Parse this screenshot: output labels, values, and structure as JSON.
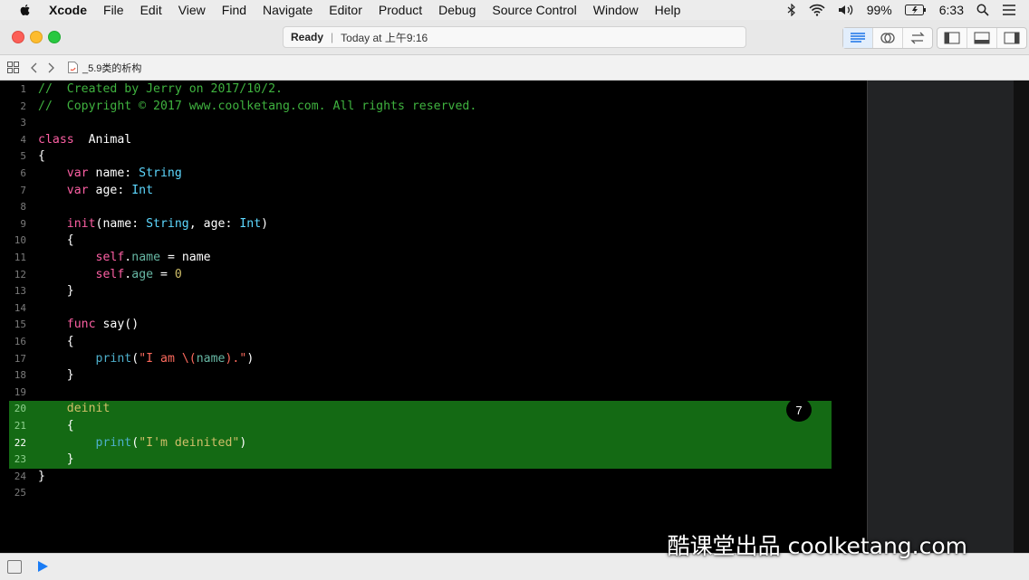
{
  "menubar": {
    "app": "Xcode",
    "items": [
      "File",
      "Edit",
      "View",
      "Find",
      "Navigate",
      "Editor",
      "Product",
      "Debug",
      "Source Control",
      "Window",
      "Help"
    ],
    "battery": "99%",
    "time": "6:33"
  },
  "toolbar": {
    "status": "Ready",
    "time": "Today at 上午9:16"
  },
  "jumpbar": {
    "file": "_5.9类的析构"
  },
  "editor": {
    "badge": "7",
    "highlight_color": "#146a14"
  },
  "code_lines": [
    {
      "n": "1",
      "segs": [
        [
          "c-comment",
          "//  Created by Jerry on 2017/10/2."
        ]
      ]
    },
    {
      "n": "2",
      "segs": [
        [
          "c-comment",
          "//  Copyright © 2017 www.coolketang.com. All rights reserved."
        ]
      ]
    },
    {
      "n": "3",
      "segs": []
    },
    {
      "n": "4",
      "segs": [
        [
          "c-key",
          "class"
        ],
        [
          "",
          "  Animal"
        ]
      ]
    },
    {
      "n": "5",
      "segs": [
        [
          "",
          "{"
        ]
      ]
    },
    {
      "n": "6",
      "segs": [
        [
          "",
          "    "
        ],
        [
          "c-key",
          "var"
        ],
        [
          "",
          " name: "
        ],
        [
          "c-type",
          "String"
        ]
      ]
    },
    {
      "n": "7",
      "segs": [
        [
          "",
          "    "
        ],
        [
          "c-key",
          "var"
        ],
        [
          "",
          " age: "
        ],
        [
          "c-type",
          "Int"
        ]
      ]
    },
    {
      "n": "8",
      "segs": []
    },
    {
      "n": "9",
      "segs": [
        [
          "",
          "    "
        ],
        [
          "c-key",
          "init"
        ],
        [
          "",
          "(name: "
        ],
        [
          "c-type",
          "String"
        ],
        [
          "",
          ", age: "
        ],
        [
          "c-type",
          "Int"
        ],
        [
          "",
          ")"
        ]
      ]
    },
    {
      "n": "10",
      "segs": [
        [
          "",
          "    {"
        ]
      ]
    },
    {
      "n": "11",
      "segs": [
        [
          "",
          "        "
        ],
        [
          "c-key",
          "self"
        ],
        [
          "",
          "."
        ],
        [
          "c-prop",
          "name"
        ],
        [
          "",
          " = name"
        ]
      ]
    },
    {
      "n": "12",
      "segs": [
        [
          "",
          "        "
        ],
        [
          "c-key",
          "self"
        ],
        [
          "",
          "."
        ],
        [
          "c-prop",
          "age"
        ],
        [
          "",
          " = "
        ],
        [
          "c-num",
          "0"
        ]
      ]
    },
    {
      "n": "13",
      "segs": [
        [
          "",
          "    }"
        ]
      ]
    },
    {
      "n": "14",
      "segs": []
    },
    {
      "n": "15",
      "segs": [
        [
          "",
          "    "
        ],
        [
          "c-key",
          "func"
        ],
        [
          "",
          " say()"
        ]
      ]
    },
    {
      "n": "16",
      "segs": [
        [
          "",
          "    {"
        ]
      ]
    },
    {
      "n": "17",
      "segs": [
        [
          "",
          "        "
        ],
        [
          "c-fn",
          "print"
        ],
        [
          "",
          "("
        ],
        [
          "c-str",
          "\"I am \\("
        ],
        [
          "c-prop",
          "name"
        ],
        [
          "c-str",
          ").\""
        ],
        [
          "",
          ")"
        ]
      ]
    },
    {
      "n": "18",
      "segs": [
        [
          "",
          "    }"
        ]
      ]
    },
    {
      "n": "19",
      "segs": []
    },
    {
      "n": "20",
      "segs": [
        [
          "",
          "    "
        ],
        [
          "c-num",
          "deinit"
        ]
      ]
    },
    {
      "n": "21",
      "segs": [
        [
          "",
          "    {"
        ]
      ]
    },
    {
      "n": "22",
      "segs": [
        [
          "",
          "        "
        ],
        [
          "c-fn",
          "print"
        ],
        [
          "",
          "("
        ],
        [
          "c-num",
          "\"I'm deinited\""
        ],
        [
          "",
          ")"
        ]
      ]
    },
    {
      "n": "23",
      "segs": [
        [
          "",
          "    }"
        ]
      ]
    },
    {
      "n": "24",
      "segs": [
        [
          "",
          "}"
        ]
      ]
    },
    {
      "n": "25",
      "segs": []
    }
  ],
  "watermark": "酷课堂出品 coolketang.com"
}
